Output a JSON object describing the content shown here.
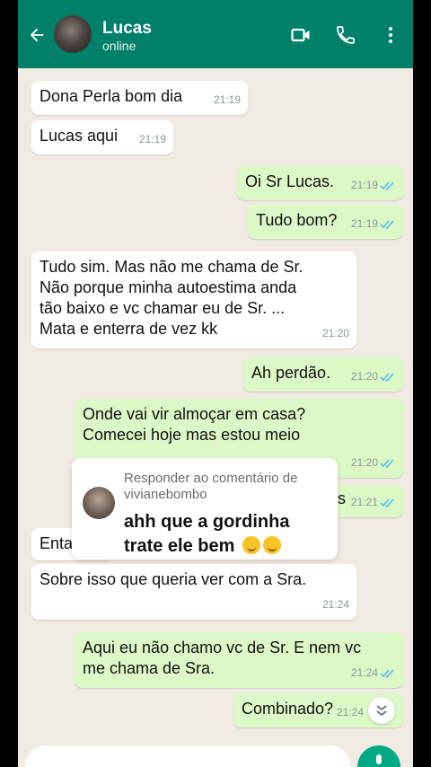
{
  "header": {
    "contact_name": "Lucas",
    "status": "online",
    "back_icon": "arrow-left-icon",
    "video_icon": "video-call-icon",
    "phone_icon": "phone-icon",
    "menu_icon": "more-vertical-icon",
    "color": "#008069"
  },
  "messages": [
    {
      "dir": "in",
      "text": "Dona Perla bom dia",
      "time": "21:19"
    },
    {
      "dir": "in",
      "text": "Lucas aqui",
      "time": "21:19"
    },
    {
      "dir": "out",
      "text": "Oi Sr Lucas.",
      "time": "21:19"
    },
    {
      "dir": "out",
      "text": "Tudo bom?",
      "time": "21:19"
    },
    {
      "dir": "in",
      "text": "Tudo sim. Mas não me chama de Sr.\nNão porque minha autoestima anda\ntão baixo e vc chamar eu de Sr. ...\nMata e enterra de vez kk",
      "time": "21:20"
    },
    {
      "dir": "out",
      "text": "Ah perdão.",
      "time": "21:20"
    },
    {
      "dir": "out",
      "text": "Onde vai vir almoçar em casa?\nComecei hoje mas estou meio",
      "time": "21:20"
    },
    {
      "dir": "out",
      "text": "s",
      "time": "21:21"
    },
    {
      "dir": "in",
      "text": "Enta",
      "time": ""
    },
    {
      "dir": "in",
      "text": "Sobre isso que queria ver com a Sra.",
      "time": "21:24"
    },
    {
      "dir": "out",
      "text": "Aqui eu não chamo vc de Sr. E nem vc\nme chama de Sra.",
      "time": "21:24"
    },
    {
      "dir": "out",
      "text": "Combinado?",
      "time": "21:24"
    }
  ],
  "reply_overlay": {
    "label": "Responder ao comentário de vivianebombo",
    "comment": "ahh que a gordinha trate ele bem",
    "emoji": "rolling-on-floor-laughing-emoji"
  },
  "footer": {
    "scroll_down_icon": "double-chevron-down-icon",
    "mic_icon": "mic-icon",
    "accent": "#00a884"
  }
}
